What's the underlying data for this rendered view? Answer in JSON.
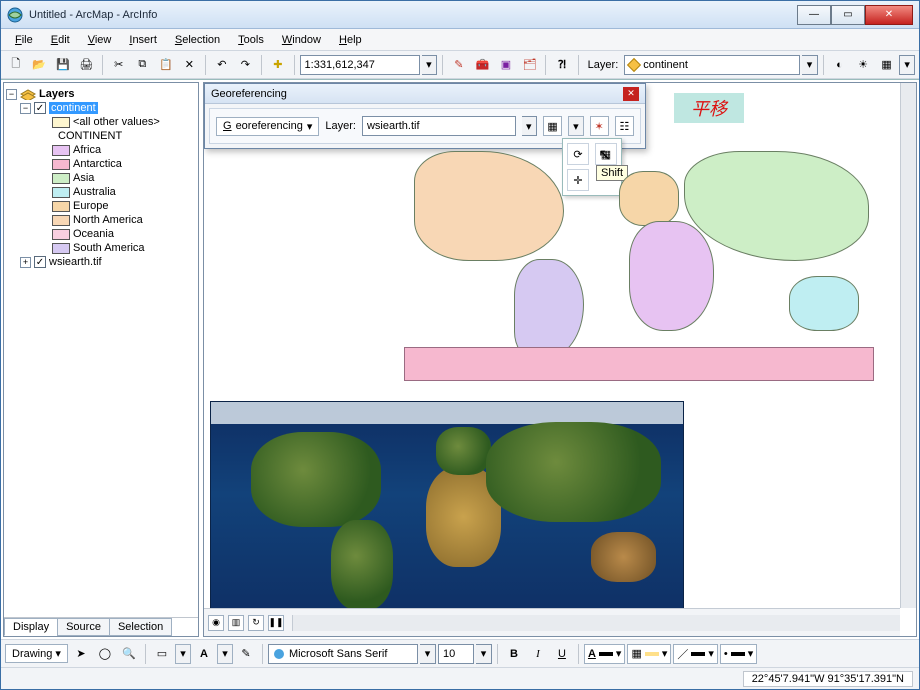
{
  "title": "Untitled - ArcMap - ArcInfo",
  "menu": [
    "File",
    "Edit",
    "View",
    "Insert",
    "Selection",
    "Tools",
    "Window",
    "Help"
  ],
  "scale": "1:331,612,347",
  "layerLabel": "Layer:",
  "layerCombo": "continent",
  "georef": {
    "title": "Georeferencing",
    "menu": "Georeferencing",
    "layerLabel": "Layer:",
    "layerValue": "wsiearth.tif",
    "tooltip": "Shift"
  },
  "annotation": "平移",
  "toc": {
    "root": "Layers",
    "layer1": {
      "name": "continent",
      "sym_all": "<all other values>",
      "field": "CONTINENT"
    },
    "continents": [
      {
        "name": "Africa",
        "color": "#e7c3f2"
      },
      {
        "name": "Antarctica",
        "color": "#f6b8cf"
      },
      {
        "name": "Asia",
        "color": "#cdeec6"
      },
      {
        "name": "Australia",
        "color": "#bfeef2"
      },
      {
        "name": "Europe",
        "color": "#f6d6a8"
      },
      {
        "name": "North America",
        "color": "#f8d7b5"
      },
      {
        "name": "Oceania",
        "color": "#f9cfe0"
      },
      {
        "name": "South America",
        "color": "#d6c9f2"
      }
    ],
    "layer2": "wsiearth.tif",
    "tabs": [
      "Display",
      "Source",
      "Selection"
    ]
  },
  "drawing": {
    "label": "Drawing",
    "font": "Microsoft Sans Serif",
    "size": "10"
  },
  "status": {
    "coords": "22°45'7.941\"W  91°35'17.391\"N"
  },
  "glyph": {
    "new": "🗋",
    "open": "📂",
    "save": "💾",
    "print": "🖨",
    "cut": "✂",
    "copy": "⧉",
    "paste": "📋",
    "delete": "✕",
    "undo": "↶",
    "redo": "↷",
    "add": "✚",
    "pencil": "✎",
    "toolbox": "🧰",
    "cube": "▣",
    "cat": "🗂",
    "ptr": "?",
    "arrow": "▾",
    "half": "◐",
    "sun": "☀",
    "plus": "+",
    "bucket": "▦",
    "rot": "⟳",
    "scale": "⤢",
    "crosshair": "✛",
    "grid": "▦",
    "star": "✶",
    "table": "☷",
    "b": "B",
    "i": "I",
    "u": "U",
    "ptr2": "➤",
    "circle": "◯",
    "rect": "▭",
    "aglyph": "A",
    "pal": "▤"
  }
}
